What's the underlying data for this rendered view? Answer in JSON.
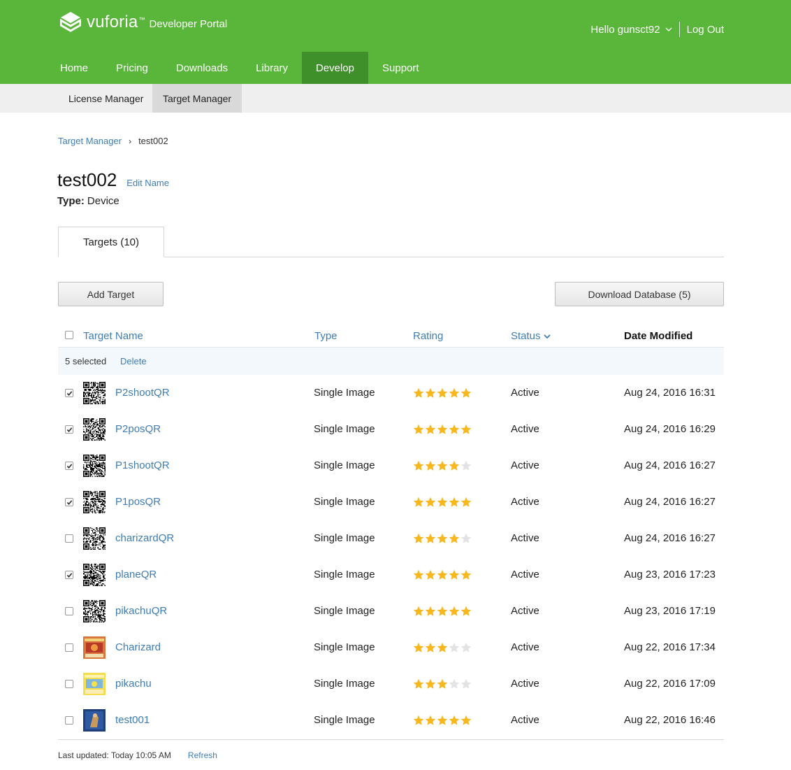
{
  "header": {
    "brand": "vuforia",
    "tm": "™",
    "portal": "Developer Portal",
    "greeting": "Hello gunsct92",
    "logout": "Log Out",
    "nav": [
      "Home",
      "Pricing",
      "Downloads",
      "Library",
      "Develop",
      "Support"
    ],
    "active_nav": "Develop",
    "subnav": [
      "License Manager",
      "Target Manager"
    ],
    "active_subnav": "Target Manager",
    "colors": {
      "primary": "#5ab63b",
      "active_nav": "#3f8f2a",
      "link": "#3f7db6",
      "star": "#f6b81c"
    }
  },
  "breadcrumb": {
    "parent": "Target Manager",
    "separator": "›",
    "current": "test002"
  },
  "database": {
    "name": "test002",
    "edit_label": "Edit Name",
    "type_label": "Type:",
    "type_value": "Device"
  },
  "tabs": [
    {
      "label": "Targets (10)",
      "active": true
    }
  ],
  "actions": {
    "add_target": "Add Target",
    "download_db": "Download Database (5)"
  },
  "table": {
    "columns": {
      "name": "Target Name",
      "type": "Type",
      "rating": "Rating",
      "status": "Status",
      "date": "Date Modified"
    },
    "status_sort_icon": "chevron-down-icon",
    "selection": {
      "count_label": "5 selected",
      "delete_label": "Delete"
    },
    "rows": [
      {
        "checked": true,
        "thumb": "qr-code",
        "name": "P2shootQR",
        "type": "Single Image",
        "rating": 5,
        "status": "Active",
        "date": "Aug 24, 2016 16:31"
      },
      {
        "checked": true,
        "thumb": "qr-code",
        "name": "P2posQR",
        "type": "Single Image",
        "rating": 5,
        "status": "Active",
        "date": "Aug 24, 2016 16:29"
      },
      {
        "checked": true,
        "thumb": "qr-code",
        "name": "P1shootQR",
        "type": "Single Image",
        "rating": 4,
        "status": "Active",
        "date": "Aug 24, 2016 16:27"
      },
      {
        "checked": true,
        "thumb": "qr-code",
        "name": "P1posQR",
        "type": "Single Image",
        "rating": 5,
        "status": "Active",
        "date": "Aug 24, 2016 16:27"
      },
      {
        "checked": false,
        "thumb": "qr-code",
        "name": "charizardQR",
        "type": "Single Image",
        "rating": 4,
        "status": "Active",
        "date": "Aug 24, 2016 16:27"
      },
      {
        "checked": true,
        "thumb": "qr-code",
        "name": "planeQR",
        "type": "Single Image",
        "rating": 5,
        "status": "Active",
        "date": "Aug 23, 2016 17:23"
      },
      {
        "checked": false,
        "thumb": "qr-code",
        "name": "pikachuQR",
        "type": "Single Image",
        "rating": 5,
        "status": "Active",
        "date": "Aug 23, 2016 17:19"
      },
      {
        "checked": false,
        "thumb": "card-red",
        "name": "Charizard",
        "type": "Single Image",
        "rating": 3,
        "status": "Active",
        "date": "Aug 22, 2016 17:34"
      },
      {
        "checked": false,
        "thumb": "card-yellow",
        "name": "pikachu",
        "type": "Single Image",
        "rating": 3,
        "status": "Active",
        "date": "Aug 22, 2016 17:09"
      },
      {
        "checked": false,
        "thumb": "card-blue",
        "name": "test001",
        "type": "Single Image",
        "rating": 5,
        "status": "Active",
        "date": "Aug 22, 2016 16:46"
      }
    ]
  },
  "footer": {
    "last_updated": "Last updated: Today 10:05 AM",
    "refresh": "Refresh"
  }
}
